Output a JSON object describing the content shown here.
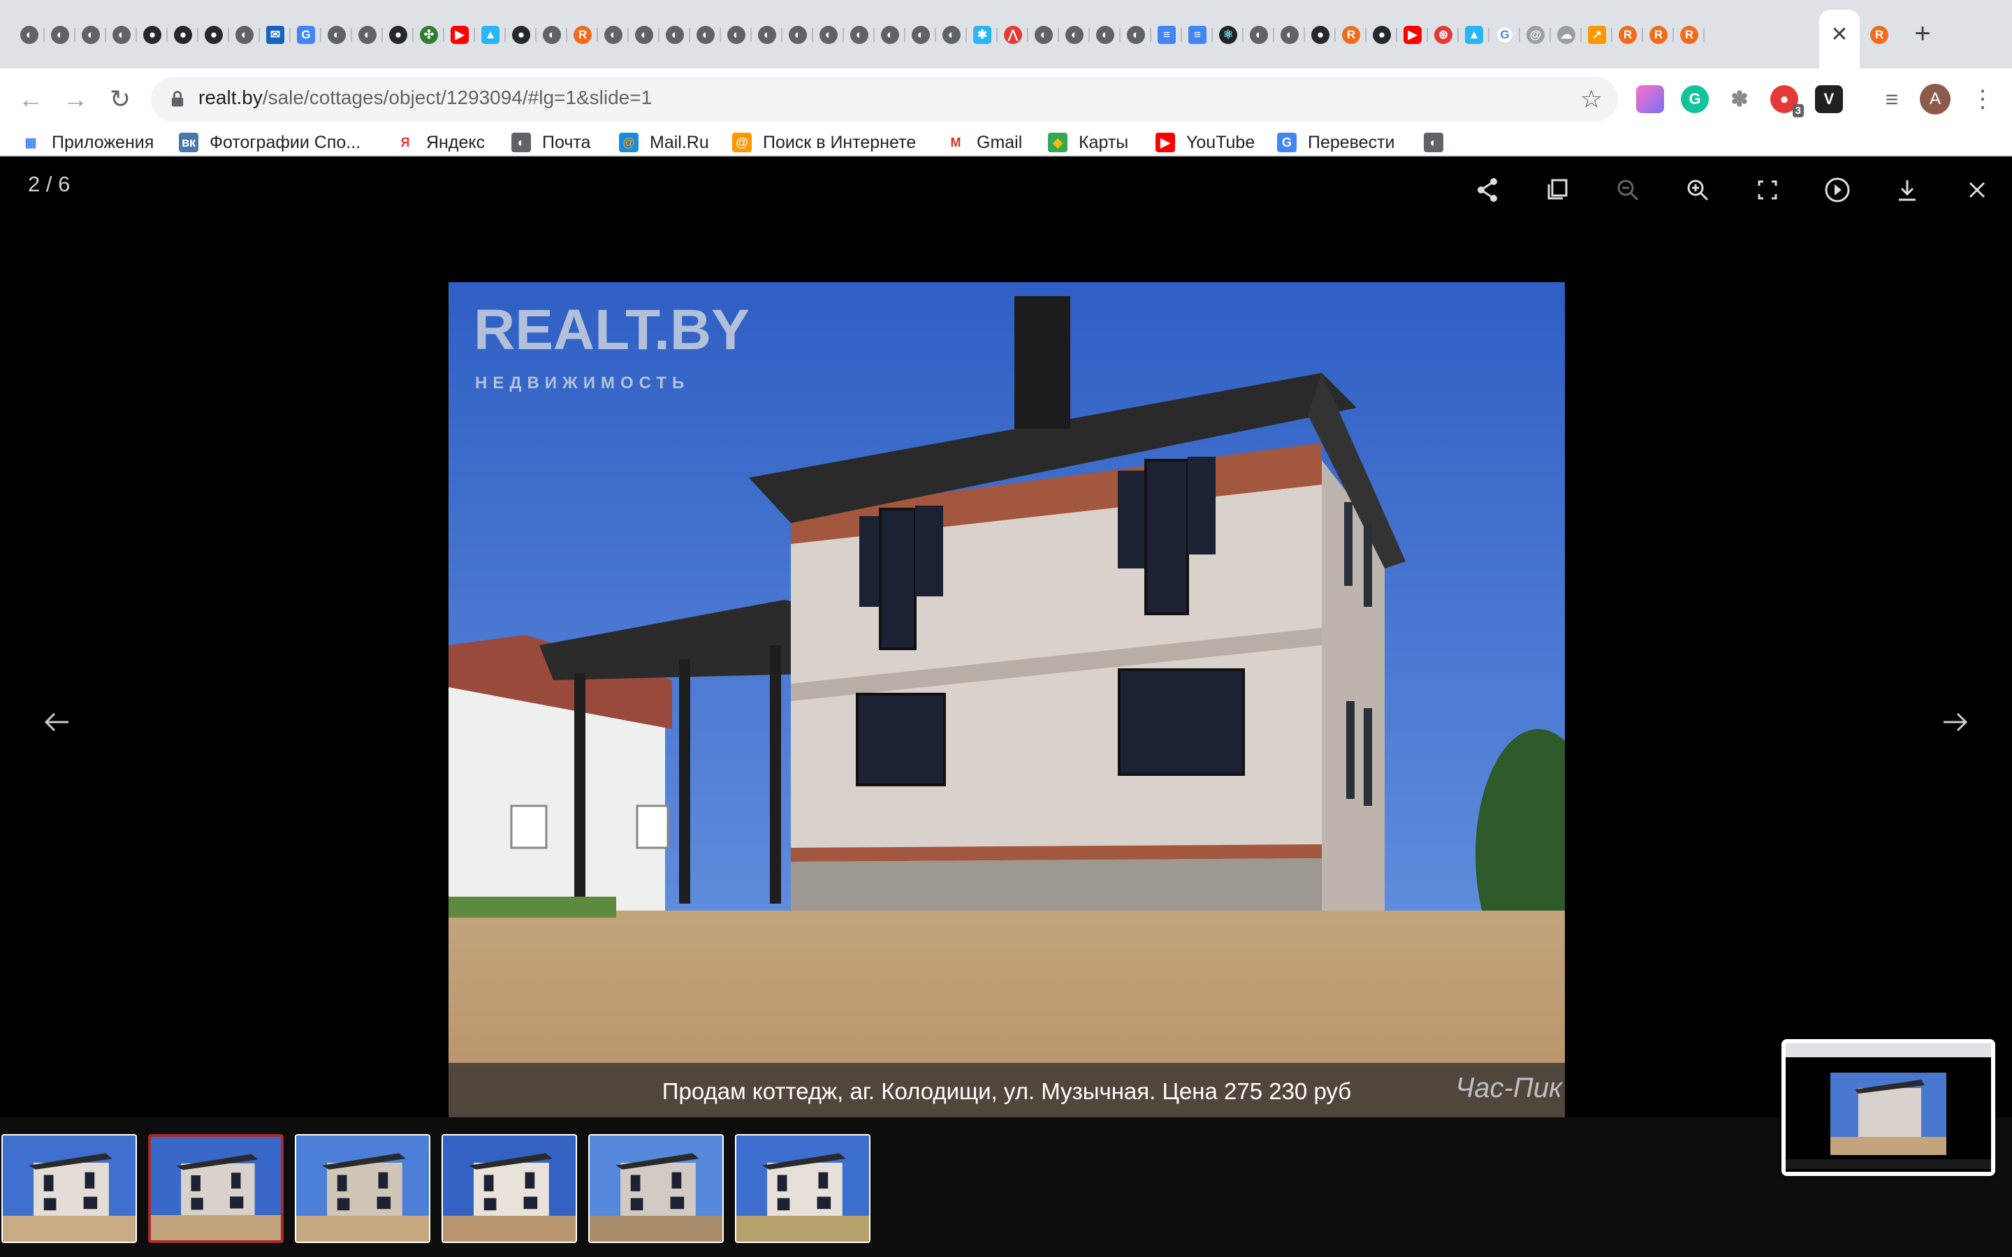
{
  "browser": {
    "tabs": [
      {
        "icon": "globe-icon"
      },
      {
        "icon": "globe-icon"
      },
      {
        "icon": "globe-icon"
      },
      {
        "icon": "globe-icon"
      },
      {
        "icon": "github-icon"
      },
      {
        "icon": "github-icon"
      },
      {
        "icon": "github-icon"
      },
      {
        "icon": "globe-icon"
      },
      {
        "icon": "mail-icon"
      },
      {
        "icon": "translate-icon"
      },
      {
        "icon": "globe-icon"
      },
      {
        "icon": "globe-icon"
      },
      {
        "icon": "github-icon"
      },
      {
        "icon": "green-logo-icon"
      },
      {
        "icon": "youtube-icon"
      },
      {
        "icon": "bird-icon"
      },
      {
        "icon": "github-icon"
      },
      {
        "icon": "globe-icon"
      },
      {
        "icon": "realt-icon"
      },
      {
        "icon": "globe-icon"
      },
      {
        "icon": "globe-icon"
      },
      {
        "icon": "globe-icon"
      },
      {
        "icon": "globe-icon"
      },
      {
        "icon": "globe-icon"
      },
      {
        "icon": "globe-icon"
      },
      {
        "icon": "globe-icon"
      },
      {
        "icon": "globe-icon"
      },
      {
        "icon": "globe-icon"
      },
      {
        "icon": "globe-icon"
      },
      {
        "icon": "globe-icon"
      },
      {
        "icon": "globe-icon"
      },
      {
        "icon": "settings-icon"
      },
      {
        "icon": "tower-icon"
      },
      {
        "icon": "globe-icon"
      },
      {
        "icon": "globe-icon"
      },
      {
        "icon": "globe-icon"
      },
      {
        "icon": "globe-icon"
      },
      {
        "icon": "docs-icon"
      },
      {
        "icon": "docs-icon"
      },
      {
        "icon": "react-icon"
      },
      {
        "icon": "globe-icon"
      },
      {
        "icon": "globe-icon"
      },
      {
        "icon": "github-icon"
      },
      {
        "icon": "realt-icon"
      },
      {
        "icon": "github-icon"
      },
      {
        "icon": "youtube-icon"
      },
      {
        "icon": "openai-icon"
      },
      {
        "icon": "bird-icon"
      },
      {
        "icon": "google-icon"
      },
      {
        "icon": "spiral-icon"
      },
      {
        "icon": "cloud-icon"
      },
      {
        "icon": "arrow-tab-icon"
      },
      {
        "icon": "realt-icon"
      },
      {
        "icon": "realt-icon"
      },
      {
        "icon": "realt-icon"
      }
    ],
    "active_tab_close": "✕",
    "after_tab_icon": "realt-icon",
    "new_tab": "+",
    "url_host": "realt.by",
    "url_path": "/sale/cottages/object/1293094/#lg=1&slide=1",
    "avatar_letter": "A",
    "extension_badge": "3"
  },
  "bookmarks": [
    {
      "label": "Приложения",
      "icon": "apps-grid-icon"
    },
    {
      "label": "Фотографии Спо...",
      "icon": "vk-icon"
    },
    {
      "label": "Яндекс",
      "icon": "yandex-icon"
    },
    {
      "label": "Почта",
      "icon": "globe-icon"
    },
    {
      "label": "Mail.Ru",
      "icon": "mailru-icon"
    },
    {
      "label": "Поиск в Интернете",
      "icon": "search-at-icon"
    },
    {
      "label": "Gmail",
      "icon": "gmail-icon"
    },
    {
      "label": "Карты",
      "icon": "maps-icon"
    },
    {
      "label": "YouTube",
      "icon": "youtube-icon"
    },
    {
      "label": "Перевести",
      "icon": "translate-icon"
    },
    {
      "label": "",
      "icon": "globe-icon"
    }
  ],
  "lightbox": {
    "counter": "2 / 6",
    "tools": [
      "share-icon",
      "copy-icon",
      "zoom-out-icon",
      "zoom-in-icon",
      "fullscreen-icon",
      "play-icon",
      "download-icon",
      "close-icon"
    ],
    "watermark_line1": "REALT.BY",
    "watermark_line2": "НЕДВИЖИМОСТЬ",
    "caption": "Продам коттедж, аг. Колодищи, ул. Музычная. Цена 275 230 руб",
    "caption_logo": "Час-Пик",
    "thumbnails_count": 6,
    "active_thumbnail": 2
  }
}
